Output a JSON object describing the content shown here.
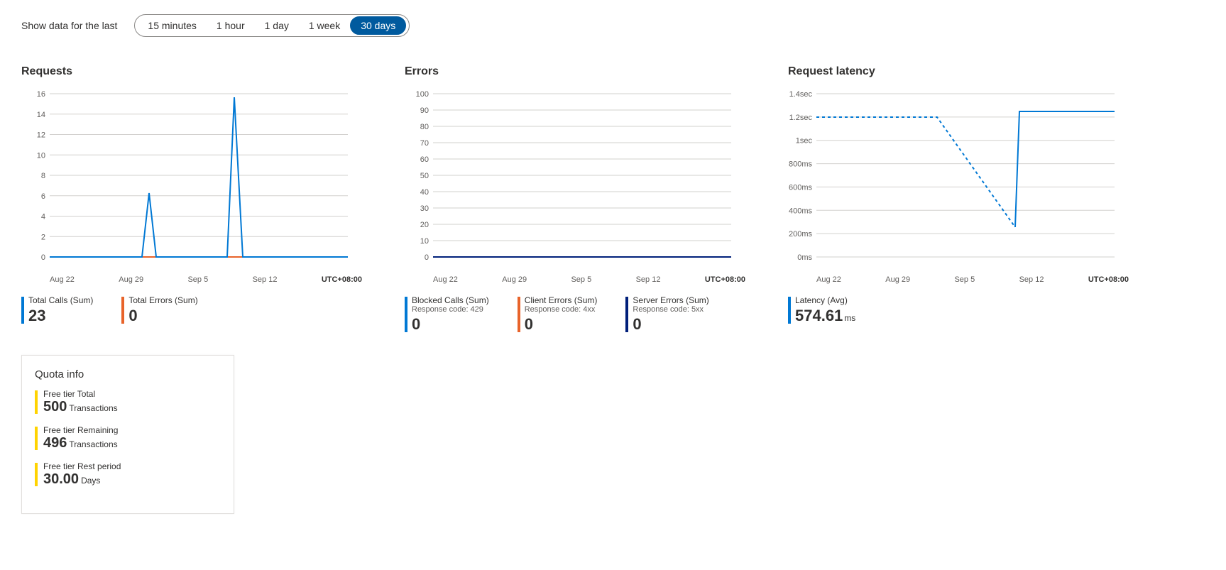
{
  "range": {
    "label": "Show data for the last",
    "options": [
      "15 minutes",
      "1 hour",
      "1 day",
      "1 week",
      "30 days"
    ],
    "selected": "30 days"
  },
  "tz": "UTC+08:00",
  "xcats": [
    "Aug 22",
    "Aug 29",
    "Sep 5",
    "Sep 12"
  ],
  "charts": {
    "requests": {
      "title": "Requests",
      "metrics": [
        {
          "label": "Total Calls (Sum)",
          "value": "23",
          "color": "#0078d4"
        },
        {
          "label": "Total Errors (Sum)",
          "value": "0",
          "color": "#e8632a"
        }
      ]
    },
    "errors": {
      "title": "Errors",
      "metrics": [
        {
          "label": "Blocked Calls (Sum)",
          "sub": "Response code: 429",
          "value": "0",
          "color": "#0078d4"
        },
        {
          "label": "Client Errors (Sum)",
          "sub": "Response code: 4xx",
          "value": "0",
          "color": "#e8632a"
        },
        {
          "label": "Server Errors (Sum)",
          "sub": "Response code: 5xx",
          "value": "0",
          "color": "#001f7a"
        }
      ]
    },
    "latency": {
      "title": "Request latency",
      "metrics": [
        {
          "label": "Latency (Avg)",
          "value": "574.61",
          "unit": "ms",
          "color": "#0078d4"
        }
      ]
    }
  },
  "quota": {
    "title": "Quota info",
    "items": [
      {
        "label": "Free tier Total",
        "value": "500",
        "unit": "Transactions"
      },
      {
        "label": "Free tier Remaining",
        "value": "496",
        "unit": "Transactions"
      },
      {
        "label": "Free tier Rest period",
        "value": "30.00",
        "unit": "Days"
      }
    ]
  },
  "chart_data": [
    {
      "type": "line",
      "title": "Requests",
      "ylim": [
        0,
        16
      ],
      "yticks": [
        0,
        2,
        4,
        6,
        8,
        10,
        12,
        14,
        16
      ],
      "x_categories": [
        "Aug 22",
        "Aug 29",
        "Sep 5",
        "Sep 12"
      ],
      "series": [
        {
          "name": "Total Calls (Sum)",
          "color": "#0078d4",
          "points": [
            [
              "Aug 22",
              0
            ],
            [
              "Aug 27",
              0
            ],
            [
              "Aug 28",
              6
            ],
            [
              "Aug 29",
              0
            ],
            [
              "Sep 4",
              0
            ],
            [
              "Sep 5",
              15
            ],
            [
              "Sep 6",
              0
            ],
            [
              "Sep 12",
              0
            ]
          ]
        },
        {
          "name": "Total Errors (Sum)",
          "color": "#e8632a",
          "points": [
            [
              "Aug 22",
              0
            ],
            [
              "Sep 12",
              0
            ]
          ]
        }
      ]
    },
    {
      "type": "line",
      "title": "Errors",
      "ylim": [
        0,
        100
      ],
      "yticks": [
        0,
        10,
        20,
        30,
        40,
        50,
        60,
        70,
        80,
        90,
        100
      ],
      "x_categories": [
        "Aug 22",
        "Aug 29",
        "Sep 5",
        "Sep 12"
      ],
      "series": [
        {
          "name": "Blocked Calls (Sum)",
          "color": "#0078d4",
          "points": [
            [
              "Aug 22",
              0
            ],
            [
              "Sep 12",
              0
            ]
          ]
        },
        {
          "name": "Client Errors (Sum)",
          "color": "#e8632a",
          "points": [
            [
              "Aug 22",
              0
            ],
            [
              "Sep 12",
              0
            ]
          ]
        },
        {
          "name": "Server Errors (Sum)",
          "color": "#001f7a",
          "points": [
            [
              "Aug 22",
              0
            ],
            [
              "Sep 12",
              0
            ]
          ]
        }
      ]
    },
    {
      "type": "line",
      "title": "Request latency",
      "ylabel": "ms",
      "ylim": [
        0,
        1400
      ],
      "yticks": [
        "0ms",
        "200ms",
        "400ms",
        "600ms",
        "800ms",
        "1sec",
        "1.2sec",
        "1.4sec"
      ],
      "x_categories": [
        "Aug 22",
        "Aug 29",
        "Sep 5",
        "Sep 12"
      ],
      "series": [
        {
          "name": "Latency (Avg) solid",
          "style": "solid",
          "color": "#0078d4",
          "points": [
            [
              "Sep 6",
              250
            ],
            [
              "Sep 6.5",
              1250
            ],
            [
              "Sep 12",
              1250
            ]
          ]
        },
        {
          "name": "Latency (Avg) dashed",
          "style": "dashed",
          "color": "#0078d4",
          "points": [
            [
              "Aug 18",
              1200
            ],
            [
              "Aug 29",
              1200
            ],
            [
              "Sep 6",
              250
            ]
          ]
        }
      ]
    }
  ]
}
